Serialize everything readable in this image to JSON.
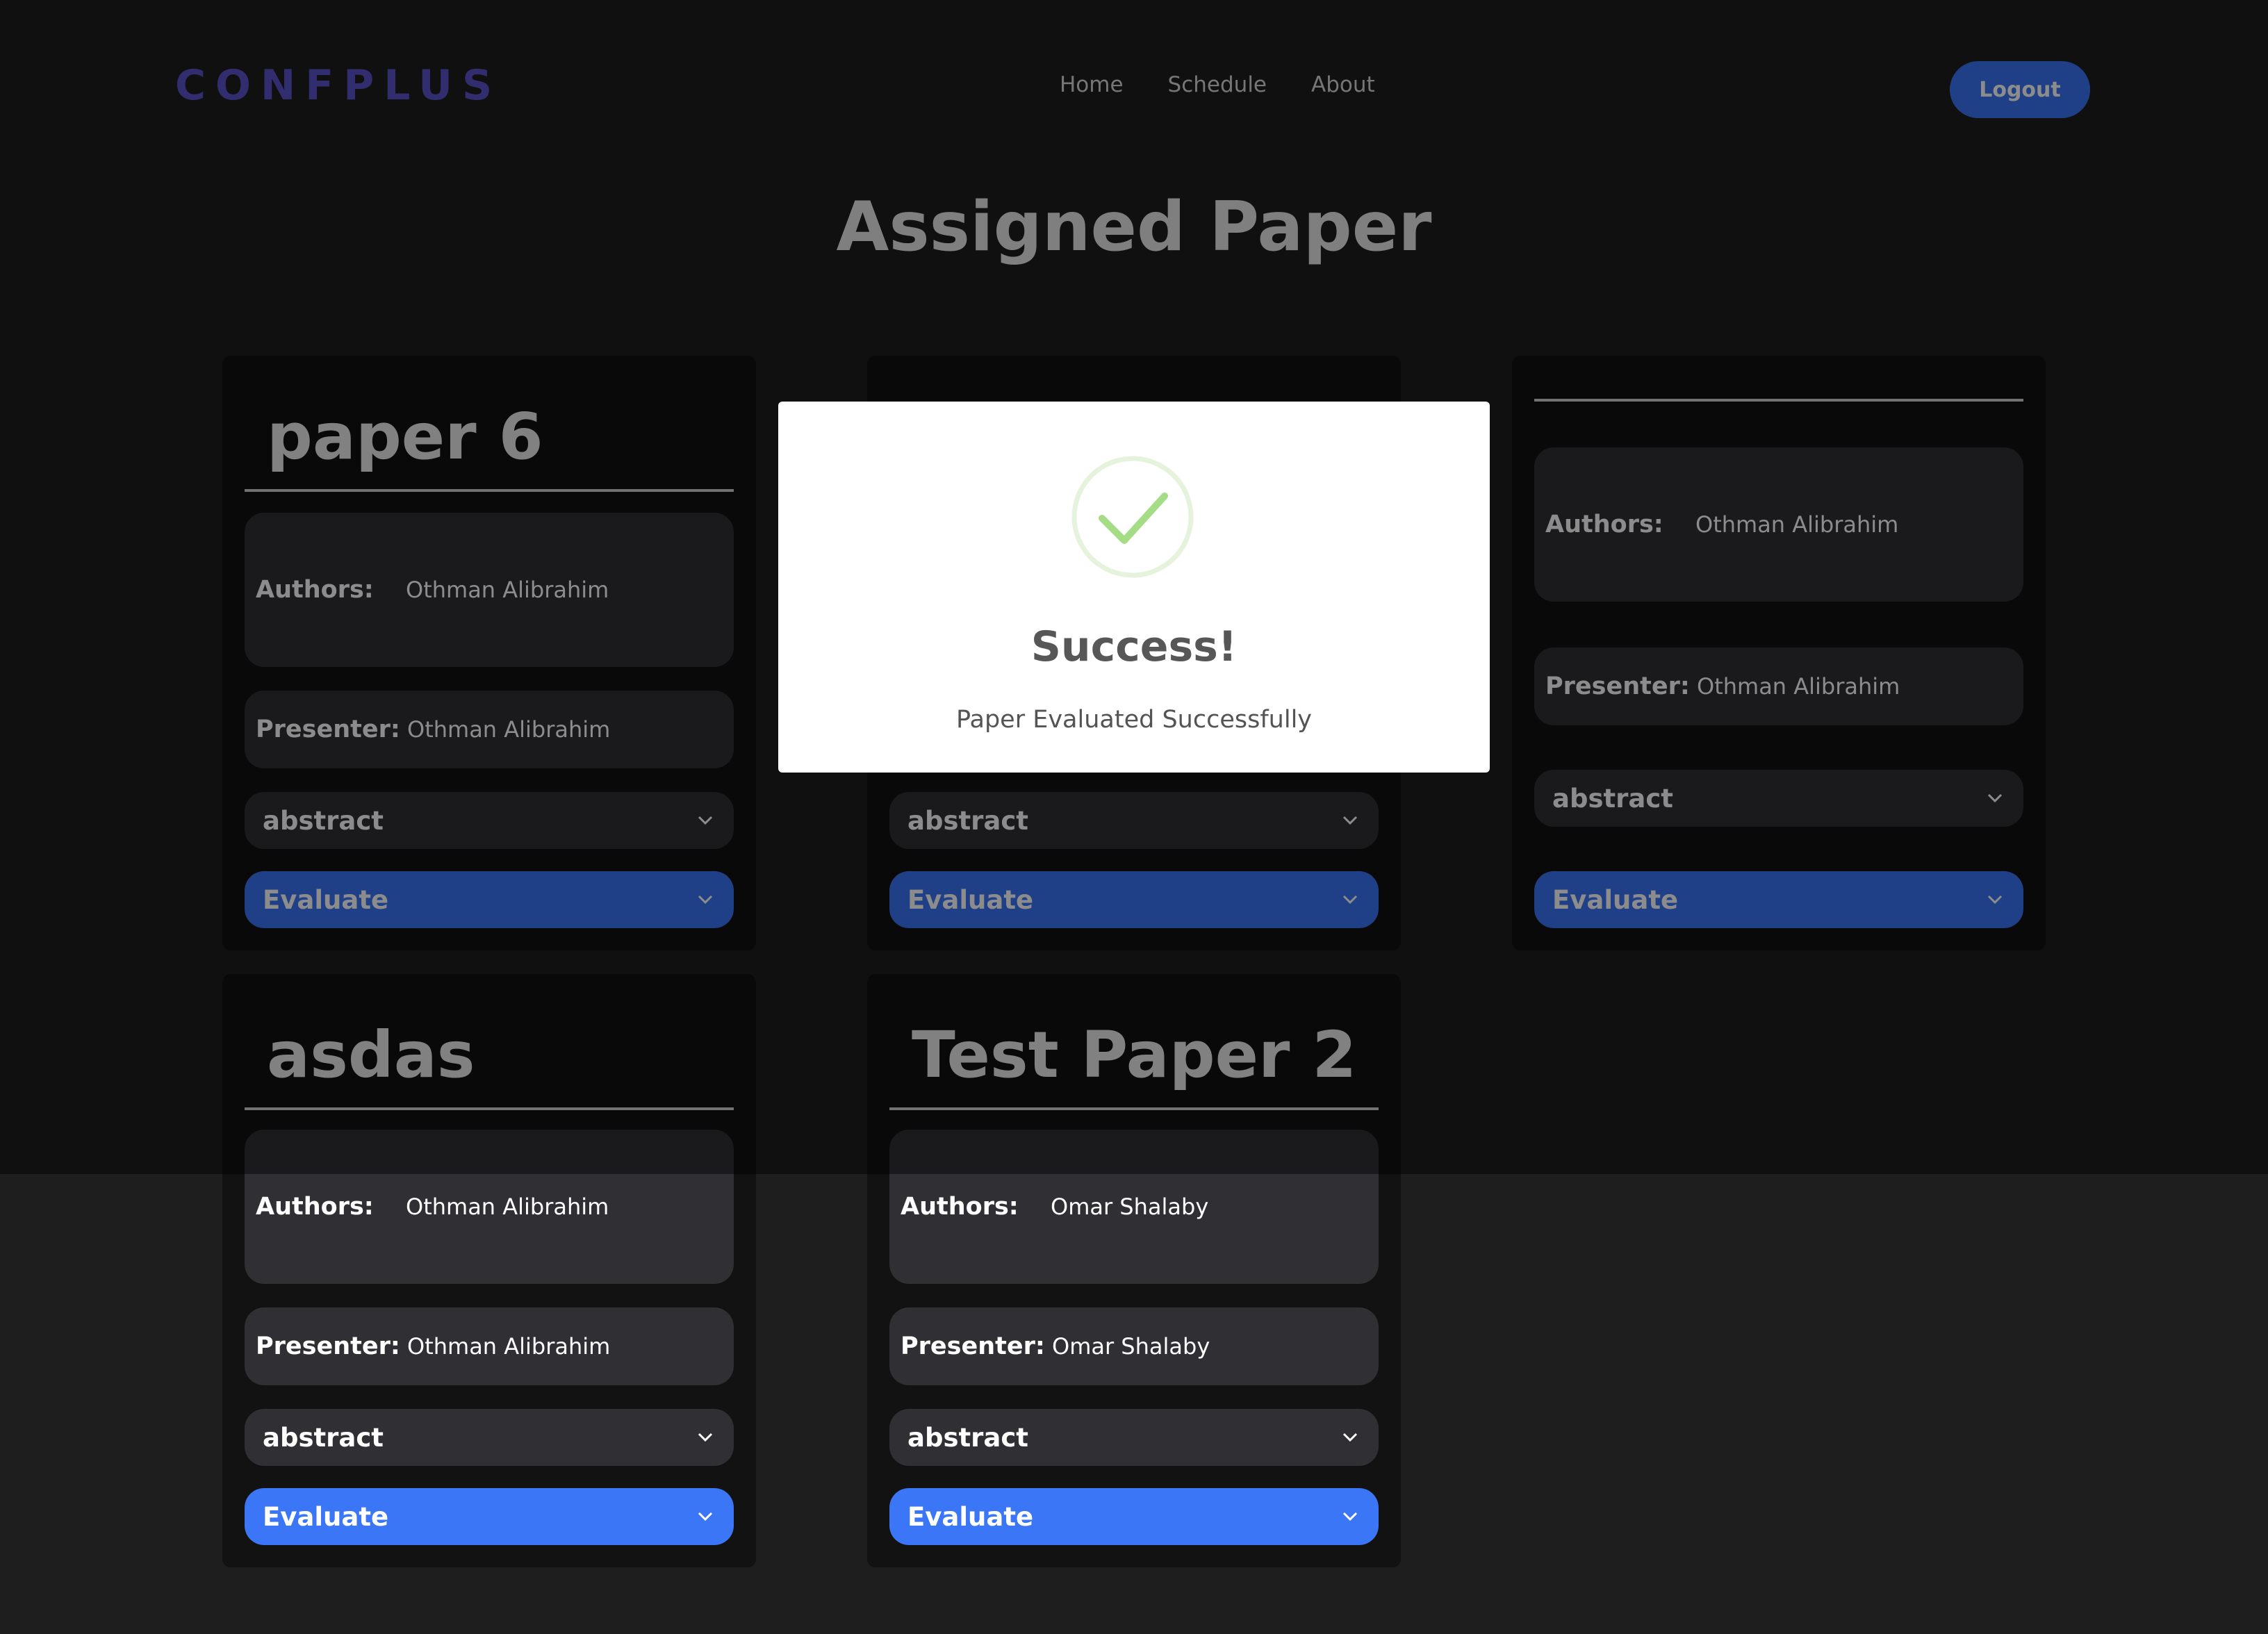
{
  "header": {
    "logo_text": "CONFPLUS",
    "nav": [
      "Home",
      "Schedule",
      "About"
    ],
    "logout_label": "Logout"
  },
  "page_title": "Assigned Paper",
  "labels": {
    "authors": "Authors:",
    "presenter": "Presenter:",
    "abstract": "abstract",
    "evaluate": "Evaluate"
  },
  "cards": [
    {
      "title": "paper 6",
      "authors": "Othman Alibrahim",
      "presenter": "Othman Alibrahim"
    },
    {
      "title": "",
      "authors": "",
      "presenter": ""
    },
    {
      "title": "",
      "authors": "Othman Alibrahim",
      "presenter": "Othman Alibrahim"
    },
    {
      "title": "asdas",
      "authors": "Othman Alibrahim",
      "presenter": "Othman Alibrahim"
    },
    {
      "title": "Test Paper 2",
      "authors": "Omar Shalaby",
      "presenter": "Omar Shalaby"
    }
  ],
  "modal": {
    "title": "Success!",
    "message": "Paper Evaluated Successfully",
    "icon": "success-check-icon"
  },
  "colors": {
    "background": "#1e1e1f",
    "card": "#121213",
    "field": "#303034",
    "accent": "#3a76f6",
    "logo": "#5b52c8",
    "success_green": "#a5dc86"
  }
}
